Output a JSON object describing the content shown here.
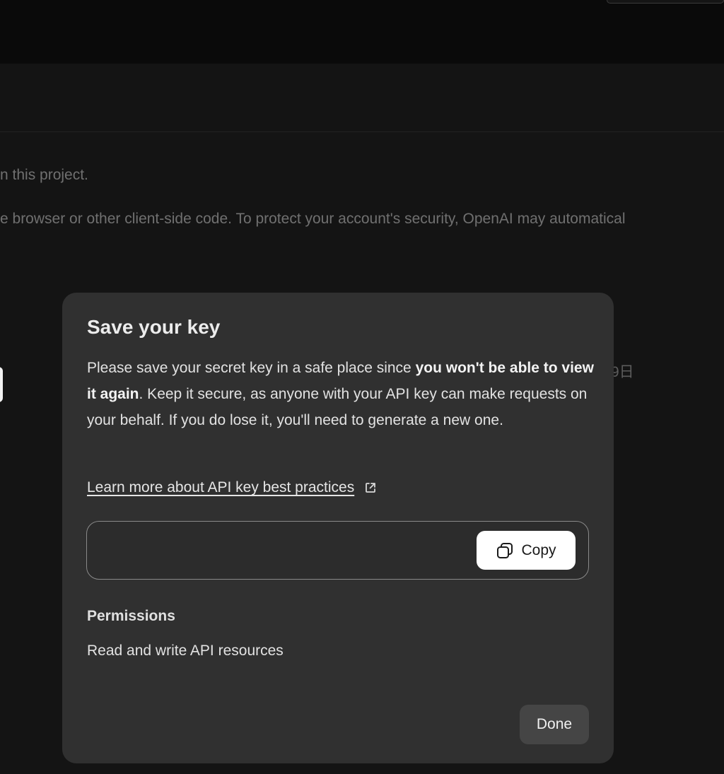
{
  "background": {
    "text_line_1": "n this project.",
    "text_line_2": "e browser or other client-side code. To protect your account's security, OpenAI may automatical",
    "date_fragment": "9日"
  },
  "modal": {
    "title": "Save your key",
    "description": {
      "part1": "Please save your secret key in a safe place since ",
      "bold": "you won't be able to view it again",
      "part2": ". Keep it secure, as anyone with your API key can make requests on your behalf. If you do lose it, you'll need to generate a new one."
    },
    "learn_link": "Learn more about API key best practices",
    "key_field": {
      "value": ""
    },
    "copy_button": {
      "label": "Copy",
      "icon": "copy-icon"
    },
    "permissions": {
      "heading": "Permissions",
      "value": "Read and write API resources"
    },
    "done_button": {
      "label": "Done"
    }
  },
  "colors": {
    "page_background": "#141414",
    "topbar": "#0a0a0a",
    "modal_background": "#303030",
    "copy_button": "#ffffff",
    "done_button": "#454545"
  }
}
